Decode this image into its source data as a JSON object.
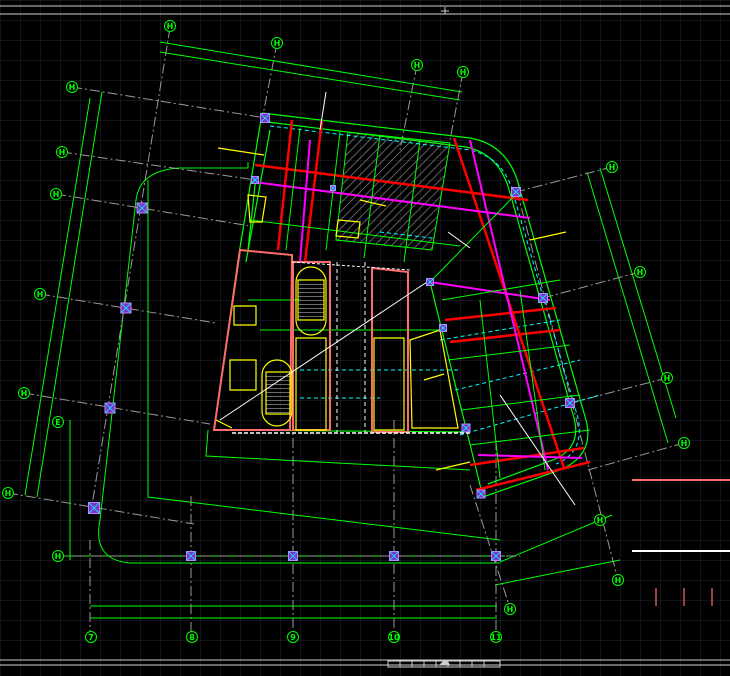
{
  "view": {
    "background": "#000000",
    "grid_color": "#23283a",
    "colors": {
      "axis": "#00ff00",
      "wall": "#00ff00",
      "beam_red": "#ff0000",
      "beam_magenta": "#ff00ff",
      "hidden_cyan": "#00ffff",
      "stair_yellow": "#ffff00",
      "column": "#7a35c8",
      "centerline": "#aaaaaa",
      "hatch": "#8a8a8a"
    },
    "icons": [
      "compass-marker-icon",
      "scale-bar-icon"
    ]
  },
  "axes": {
    "bottom_labels": [
      "7",
      "8",
      "9",
      "10",
      "11"
    ],
    "left_labels": [
      "H",
      "H",
      "H",
      "H",
      "H",
      "H",
      "E",
      "H",
      "H"
    ],
    "top_labels": [
      "H",
      "H",
      "H",
      "H"
    ],
    "right_labels": [
      "H",
      "H",
      "H",
      "H",
      "H",
      "H"
    ]
  }
}
